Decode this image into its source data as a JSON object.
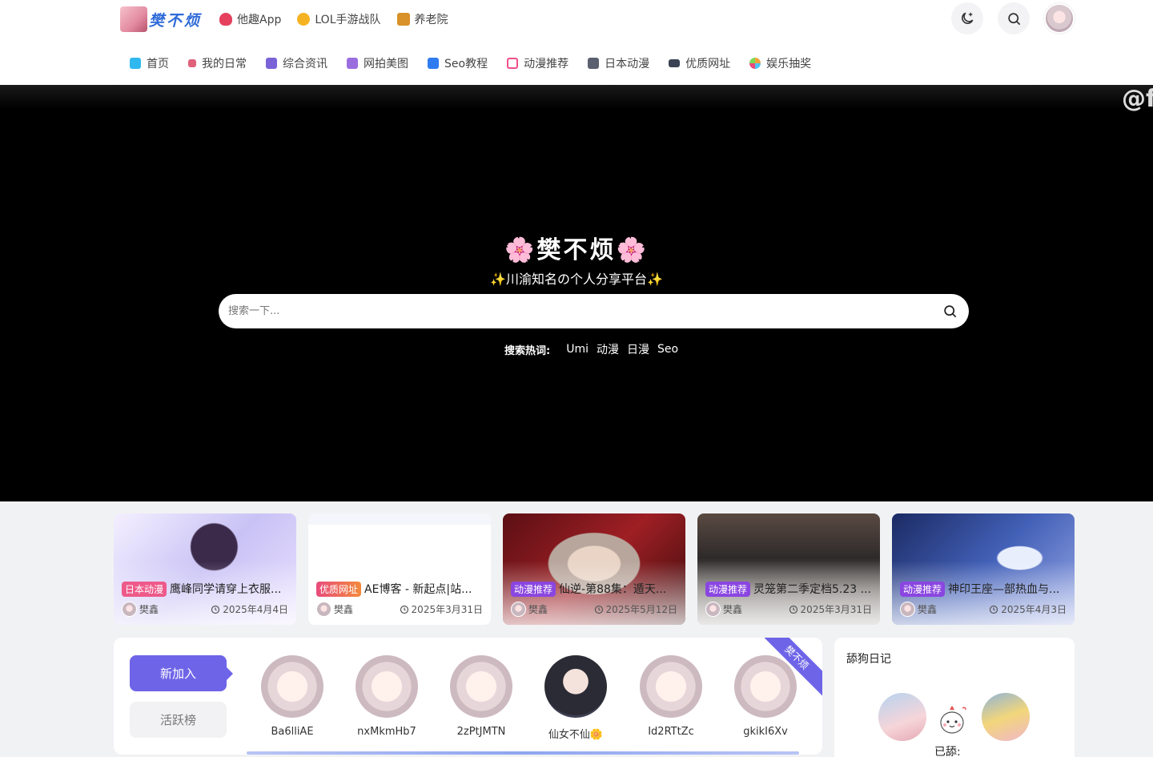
{
  "header": {
    "logo_text": "樊不烦",
    "top_links": [
      {
        "label": "他趣App",
        "icon": "heart-people-icon",
        "color": "#e5405e"
      },
      {
        "label": "LOL手游战队",
        "icon": "lol-coin-icon",
        "color": "#f5b324"
      },
      {
        "label": "养老院",
        "icon": "temple-icon",
        "color": "#d9912a"
      }
    ],
    "nav": [
      {
        "label": "首页",
        "icon": "home-icon",
        "color": "#2fb8f0"
      },
      {
        "label": "我的日常",
        "icon": "calendar-icon",
        "color": "#e0617a"
      },
      {
        "label": "综合资讯",
        "icon": "news-icon",
        "color": "#7a63d8"
      },
      {
        "label": "网拍美图",
        "icon": "image-icon",
        "color": "#9b6ee0"
      },
      {
        "label": "Seo教程",
        "icon": "book-icon",
        "color": "#2f7bf0"
      },
      {
        "label": "动漫推荐",
        "icon": "tv-icon",
        "color": "#ee4f8c"
      },
      {
        "label": "日本动漫",
        "icon": "play-icon",
        "color": "#5a6070"
      },
      {
        "label": "优质网址",
        "icon": "truck-icon",
        "color": "#3a4254"
      },
      {
        "label": "娱乐抽奖",
        "icon": "pinwheel-icon",
        "color": "#f2a23a"
      }
    ]
  },
  "hero": {
    "watermark": "@f",
    "title": "🌸樊不烦🌸",
    "subtitle": "✨川渝知名の个人分享平台✨",
    "search_placeholder": "搜索一下...",
    "hot_label": "搜索热词:",
    "hot_keywords": [
      "Umi",
      "动漫",
      "日漫",
      "Seo"
    ]
  },
  "cards": [
    {
      "tag": "日本动漫",
      "tag_color": "#ee5a8a",
      "title": "鹰峰同学请穿上衣服...",
      "author": "樊鑫",
      "date": "2025年4月4日"
    },
    {
      "tag": "优质网址",
      "tag_color": "#e94b7b",
      "title": "AE博客 - 新起点|站...",
      "author": "樊鑫",
      "date": "2025年3月31日"
    },
    {
      "tag": "动漫推荐",
      "tag_color": "#8a46e0",
      "title": "仙逆-第88集：遁天...",
      "author": "樊鑫",
      "date": "2025年5月12日"
    },
    {
      "tag": "动漫推荐",
      "tag_color": "#8a46e0",
      "title": "灵笼第二季定档5.23 ...",
      "author": "樊鑫",
      "date": "2025年3月31日"
    },
    {
      "tag": "动漫推荐",
      "tag_color": "#8a46e0",
      "title": "神印王座—部热血与...",
      "author": "樊鑫",
      "date": "2025年4月3日"
    }
  ],
  "members": {
    "tab_new": "新加入",
    "tab_active": "活跃榜",
    "ribbon": "樊不烦",
    "list": [
      {
        "name": "Ba6lliAE"
      },
      {
        "name": "nxMkmHb7"
      },
      {
        "name": "2zPtJMTN"
      },
      {
        "name": "仙女不仙🌼"
      },
      {
        "name": "Id2RTtZc"
      },
      {
        "name": "gkikI6Xv"
      }
    ]
  },
  "diary": {
    "title": "舔狗日记",
    "licked_label": "已舔:"
  }
}
